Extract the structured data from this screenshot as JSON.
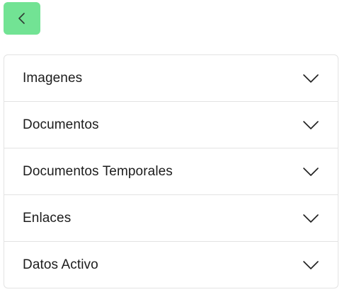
{
  "back_button": {
    "icon": "chevron-left-icon",
    "color": "#72e394"
  },
  "accordion": {
    "items": [
      {
        "label": "Imagenes",
        "icon": "chevron-down-icon"
      },
      {
        "label": "Documentos",
        "icon": "chevron-down-icon"
      },
      {
        "label": "Documentos Temporales",
        "icon": "chevron-down-icon"
      },
      {
        "label": "Enlaces",
        "icon": "chevron-down-icon"
      },
      {
        "label": "Datos Activo",
        "icon": "chevron-down-icon"
      }
    ]
  }
}
